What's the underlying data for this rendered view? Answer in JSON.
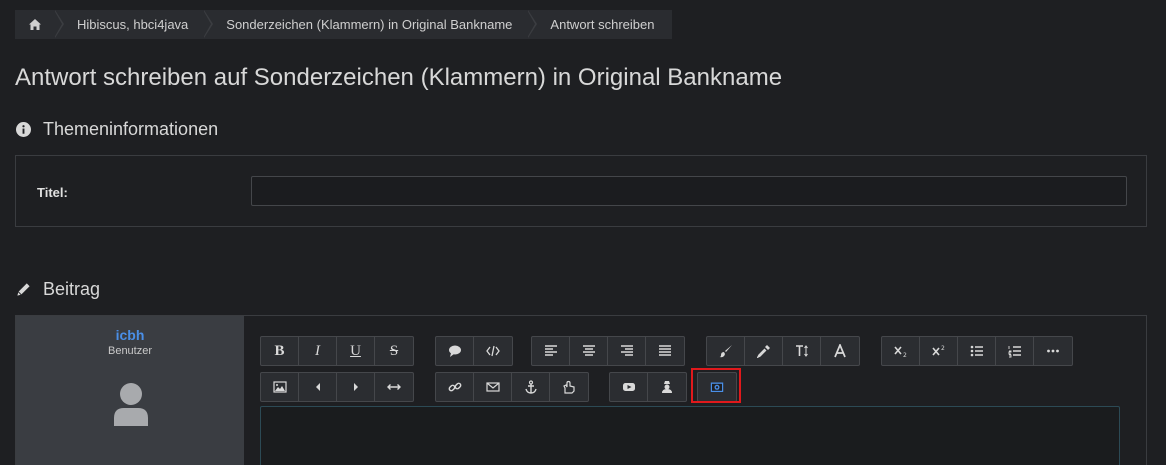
{
  "breadcrumb": {
    "home_icon": "home-icon",
    "items": [
      "Hibiscus, hbci4java",
      "Sonderzeichen (Klammern) in Original Bankname",
      "Antwort schreiben"
    ]
  },
  "page_title": "Antwort schreiben auf Sonderzeichen (Klammern) in Original Bankname",
  "topic_section": {
    "icon": "info-circle-icon",
    "heading": "Themeninformationen",
    "title_label": "Titel:",
    "title_value": ""
  },
  "post_section": {
    "icon": "pencil-icon",
    "heading": "Beitrag",
    "user": {
      "name": "icbh",
      "role": "Benutzer"
    }
  },
  "toolbar": {
    "row1": [
      [
        "B",
        "I",
        "U",
        "S"
      ],
      [
        "quote-icon",
        "code-icon"
      ],
      [
        "align-left-icon",
        "align-center-icon",
        "align-right-icon",
        "justify-icon"
      ],
      [
        "paint-brush-icon",
        "eyedropper-icon",
        "text-height-icon",
        "font-icon"
      ],
      [
        "subscript-icon",
        "superscript-icon",
        "list-ul-icon",
        "list-ol-icon",
        "ellipsis-icon"
      ]
    ],
    "row2": [
      [
        "image-icon",
        "caret-left-icon",
        "caret-right-icon",
        "arrows-h-icon"
      ],
      [
        "link-icon",
        "envelope-icon",
        "anchor-icon",
        "hand-point-icon"
      ],
      [
        "youtube-icon",
        "user-secret-icon"
      ],
      [
        "camera-icon"
      ]
    ]
  },
  "colors": {
    "accent": "#4a8fe7",
    "highlight": "#e0191c",
    "background": "#1e1f22"
  }
}
